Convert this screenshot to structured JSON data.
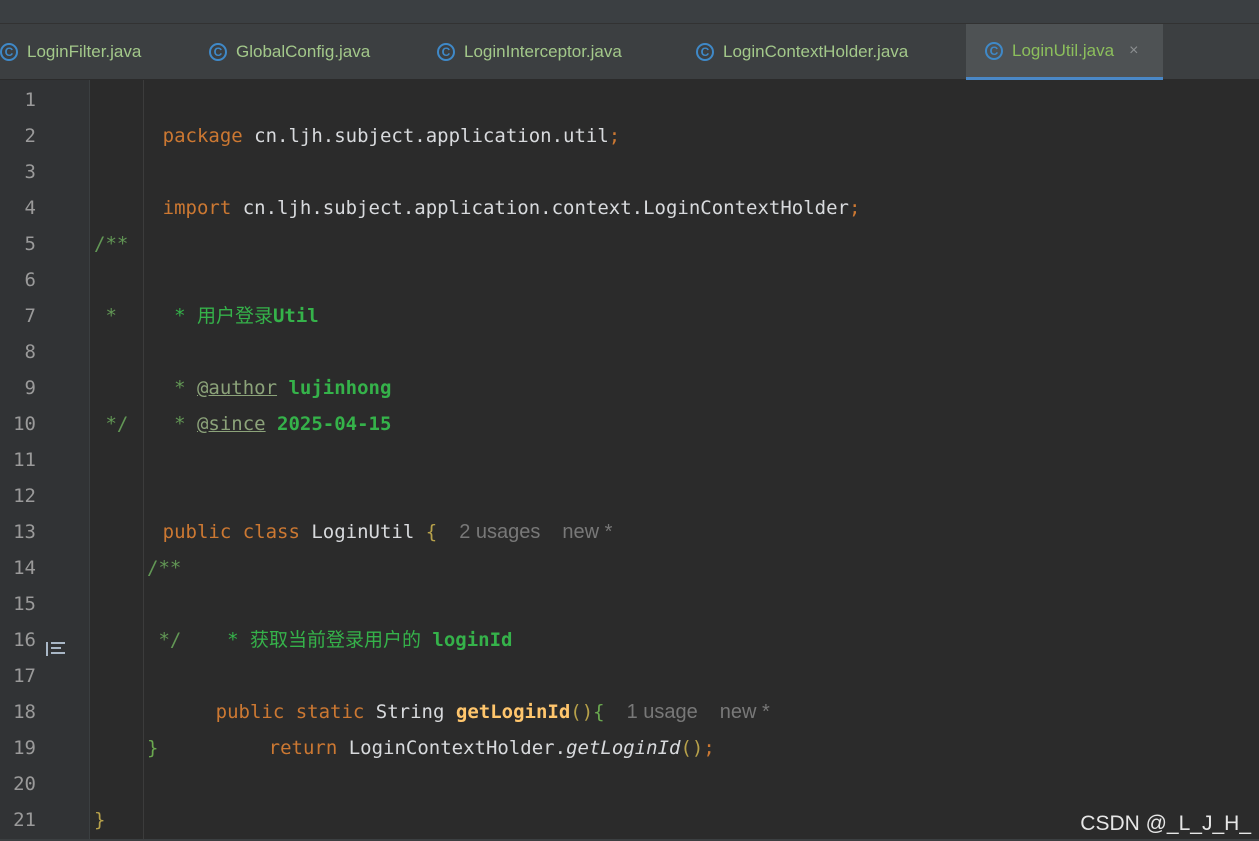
{
  "tabs": [
    {
      "label": "LoginFilter.java",
      "icon": "java-class-icon",
      "active": false
    },
    {
      "label": "GlobalConfig.java",
      "icon": "java-class-icon",
      "active": false
    },
    {
      "label": "LoginInterceptor.java",
      "icon": "java-class-icon",
      "active": false
    },
    {
      "label": "LoginContextHolder.java",
      "icon": "java-class-icon",
      "active": false
    },
    {
      "label": "LoginUtil.java",
      "icon": "java-class-icon",
      "active": true
    }
  ],
  "tab_close_label": "×",
  "line_numbers": [
    "1",
    "2",
    "3",
    "4",
    "5",
    "6",
    "7",
    "8",
    "9",
    "10",
    "11",
    "12",
    "13",
    "14",
    "15",
    "16",
    "17",
    "18",
    "19",
    "20",
    "21"
  ],
  "code": {
    "line1": {
      "keyword": "package",
      "path": " cn.ljh.subject.application.util",
      "semicolon": ";"
    },
    "line3": {
      "keyword": "import",
      "path": " cn.ljh.subject.application.context.LoginContextHolder",
      "semicolon": ";"
    },
    "line5": "/**",
    "line6": {
      "prefix": " * 用户登录",
      "word": "Util"
    },
    "line7": " *",
    "line8": {
      "prefix": " * ",
      "tag": "@author",
      "value": " lujinhong"
    },
    "line9": {
      "prefix": " * ",
      "tag": "@since",
      "value": " 2025-04-15"
    },
    "line10": " */",
    "line12": {
      "keyword1": "public",
      "keyword2": " class",
      "name": " LoginUtil",
      "brace": " {",
      "hint_usages": "2 usages",
      "hint_new": "new *"
    },
    "line14": "/**",
    "line15": {
      "prefix": " * 获取当前登录用户的 ",
      "word": "loginId"
    },
    "line16": " */",
    "line17": {
      "keyword1": "public",
      "keyword2": " static",
      "type": " String",
      "method": " getLoginId",
      "parens": "()",
      "brace": "{",
      "hint_usages": "1 usage",
      "hint_new": "new *"
    },
    "line18": {
      "keyword": "return",
      "receiver": " LoginContextHolder.",
      "method": "getLoginId",
      "parens": "()",
      "semicolon": ";"
    },
    "line19": "}",
    "line21": "}"
  },
  "watermark": "CSDN @_L_J_H_",
  "colors": {
    "background": "#2b2b2b",
    "gutter": "#313335",
    "tab_bar": "#3c3f41",
    "active_tab": "#4e5254",
    "keyword": "#cc7832",
    "comment": "#629755",
    "method": "#ffc66d",
    "class_icon": "#3f89c8"
  }
}
